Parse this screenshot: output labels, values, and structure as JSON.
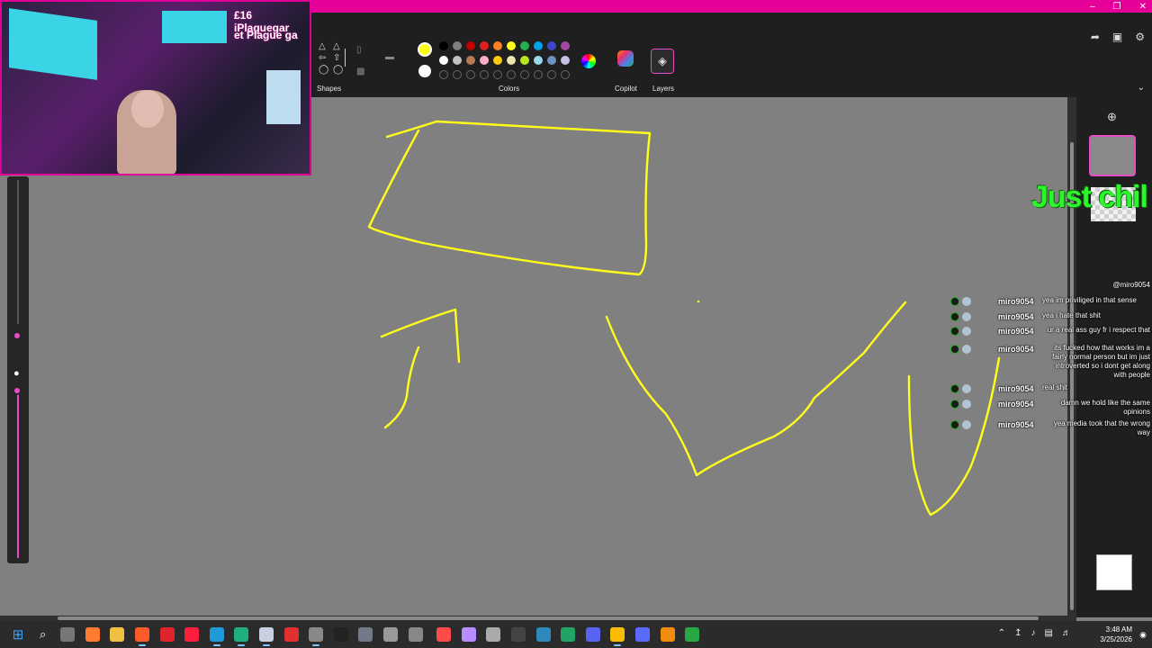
{
  "ribbon": {
    "sections": {
      "shapes_label": "Shapes",
      "colors_label": "Colors",
      "copilot_label": "Copilot",
      "layers_label": "Layers"
    },
    "current_colors": [
      "#ffff1a",
      "#ffffff"
    ],
    "palette": [
      "#000000",
      "#7f7f7f",
      "#c00000",
      "#e02020",
      "#ff7f27",
      "#ffff1a",
      "#22b14c",
      "#00a2e8",
      "#3f48cc",
      "#a349a4",
      "#ffffff",
      "#c3c3c3",
      "#b97a57",
      "#ffaec9",
      "#ffc90e",
      "#efe4b0",
      "#b5e61d",
      "#99d9ea",
      "#7092be",
      "#c8bfe7",
      "",
      "",
      "",
      "",
      "",
      "",
      "",
      "",
      "",
      ""
    ]
  },
  "webcam": {
    "text_line1": "£16 iPlaguegar",
    "text_line2": "et Plague ga"
  },
  "overlay": {
    "title": "Just chil"
  },
  "chat": {
    "top_fragment": "@miro9054",
    "messages": [
      {
        "user": "miro9054",
        "text": "yea im priviliged in that sense"
      },
      {
        "user": "miro9054",
        "text": "yea i hate that shit"
      },
      {
        "user": "miro9054",
        "text": "ur a real ass guy fr i respect that"
      },
      {
        "user": "miro9054",
        "text": "its fucked how that works im a fairly normal person but im just introverted so i dont get along with people"
      },
      {
        "user": "miro9054",
        "text": "real shit"
      },
      {
        "user": "miro9054",
        "text": "damn we hold like the same opinions"
      },
      {
        "user": "miro9054",
        "text": "yea media took that the wrong way"
      }
    ]
  },
  "taskbar": {
    "clock_time": "3:48 AM",
    "clock_date": "3/25/2026",
    "apps": [
      "windows-start",
      "search",
      "task-view",
      "copilot",
      "file-explorer",
      "firefox",
      "opera",
      "opera-gx",
      "edge",
      "edge-dev",
      "steam",
      "game-app",
      "obs",
      "epic-games",
      "camera",
      "github",
      "settings",
      "vivaldi",
      "update-app",
      "app-d",
      "notion",
      "media-player",
      "spreadsheet",
      "discord",
      "chrome",
      "calculator",
      "vlc",
      "app-g"
    ]
  }
}
